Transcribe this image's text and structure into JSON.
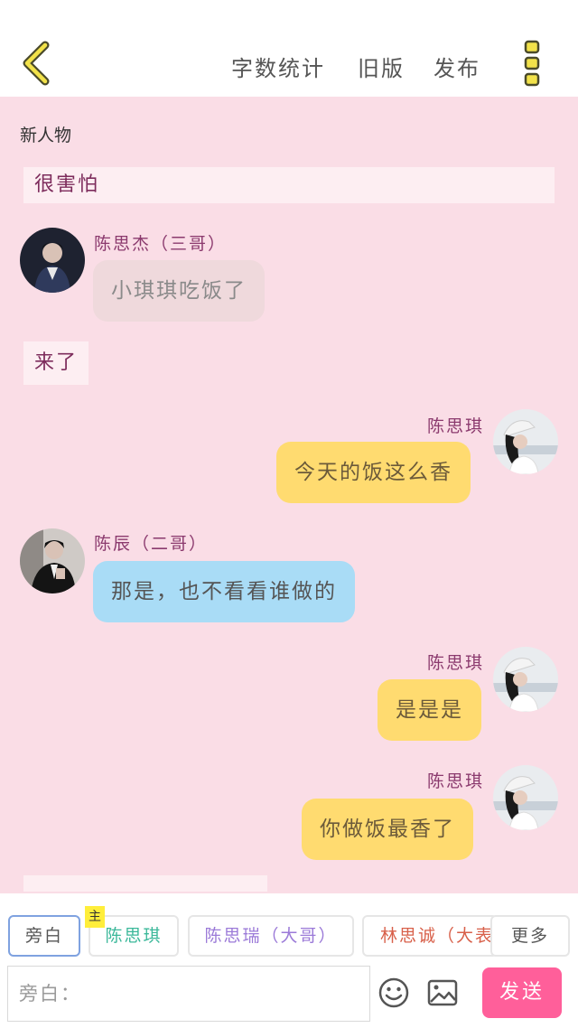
{
  "header": {
    "word_count": "字数统计",
    "old_version": "旧版",
    "publish": "发布"
  },
  "chat": {
    "new_character": "新人物",
    "narration_1": "很害怕",
    "msg_1": {
      "speaker": "陈思杰（三哥）",
      "text": "小琪琪吃饭了"
    },
    "narration_2": "来了",
    "msg_2": {
      "speaker": "陈思琪",
      "text": "今天的饭这么香"
    },
    "msg_3": {
      "speaker": "陈辰（二哥）",
      "text": "那是，也不看看谁做的"
    },
    "msg_4": {
      "speaker": "陈思琪",
      "text": "是是是"
    },
    "msg_5": {
      "speaker": "陈思琪",
      "text": "你做饭最香了"
    }
  },
  "composer": {
    "tabs": {
      "narrator": "旁白",
      "main_badge": "主",
      "char_1": "陈思琪",
      "char_2": "陈思瑞（大哥）",
      "char_3": "林思诚（大表",
      "more": "更多"
    },
    "placeholder": "旁白：",
    "send": "发送"
  },
  "colors": {
    "background": "#fadde6",
    "self_bubble": "#ffdb70",
    "blue_bubble": "#a9dcf6",
    "send_button": "#ff5f9a"
  }
}
